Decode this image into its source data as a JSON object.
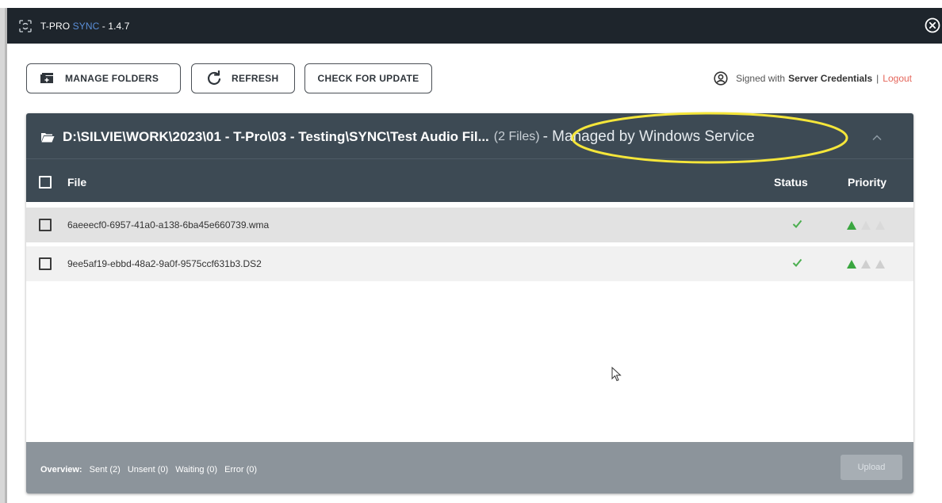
{
  "window": {
    "title_prefix": "T-PRO",
    "title_accent": "SYNC",
    "title_version": " - 1.4.7"
  },
  "toolbar": {
    "manage_label": "MANAGE FOLDERS",
    "refresh_label": "REFRESH",
    "update_label": "CHECK FOR UPDATE"
  },
  "signin": {
    "prefix": "Signed with",
    "credential": "Server Credentials",
    "separator": "|",
    "logout": "Logout"
  },
  "folder": {
    "path": "D:\\SILVIE\\WORK\\2023\\01 - T-Pro\\03 - Testing\\SYNC\\Test Audio Fil...",
    "files_count": "(2 Files)",
    "managed": "- Managed by Windows Service"
  },
  "columns": {
    "file": "File",
    "status": "Status",
    "priority": "Priority"
  },
  "rows": [
    {
      "name": "6aeeecf0-6957-41a0-a138-6ba45e660739.wma",
      "status": "sent",
      "priority": 1
    },
    {
      "name": "9ee5af19-ebbd-48a2-9a0f-9575ccf631b3.DS2",
      "status": "sent",
      "priority": 1
    }
  ],
  "footer": {
    "overview_label": "Overview:",
    "sent": "Sent (2)",
    "unsent": "Unsent (0)",
    "waiting": "Waiting (0)",
    "error": "Error (0)",
    "upload_label": "Upload"
  },
  "colors": {
    "titlebar": "#1e252c",
    "accent": "#5b8fd8",
    "panel_header": "#3d4a54",
    "status_ok": "#4caf50",
    "logout": "#e5665b",
    "annotation": "#f5e63a"
  },
  "icons": [
    "app-logo-icon",
    "close-circle-icon",
    "folder-add-icon",
    "refresh-icon",
    "user-circle-icon",
    "folder-open-icon",
    "chevron-up-icon",
    "checkmark-icon",
    "priority-triangle-icon",
    "mouse-cursor-icon"
  ]
}
